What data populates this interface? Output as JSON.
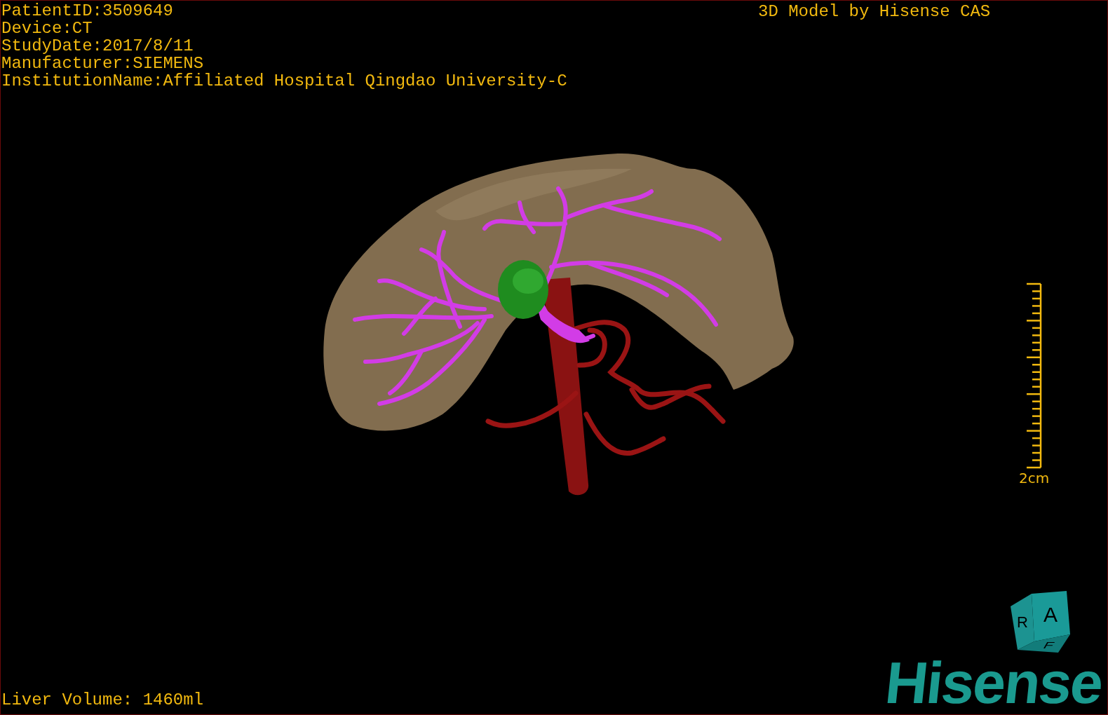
{
  "patient_info": [
    "PatientID:3509649",
    "Device:CT",
    "StudyDate:2017/8/11",
    "Manufacturer:SIEMENS",
    "InstitutionName:Affiliated Hospital Qingdao University-C"
  ],
  "model_credit": "3D Model by Hisense CAS",
  "scale_bar": {
    "label": "2cm"
  },
  "orientation_cube": {
    "side": "R",
    "front": "A",
    "bottom": "F"
  },
  "logo": "Hisense",
  "liver_volume": "Liver Volume: 1460ml"
}
